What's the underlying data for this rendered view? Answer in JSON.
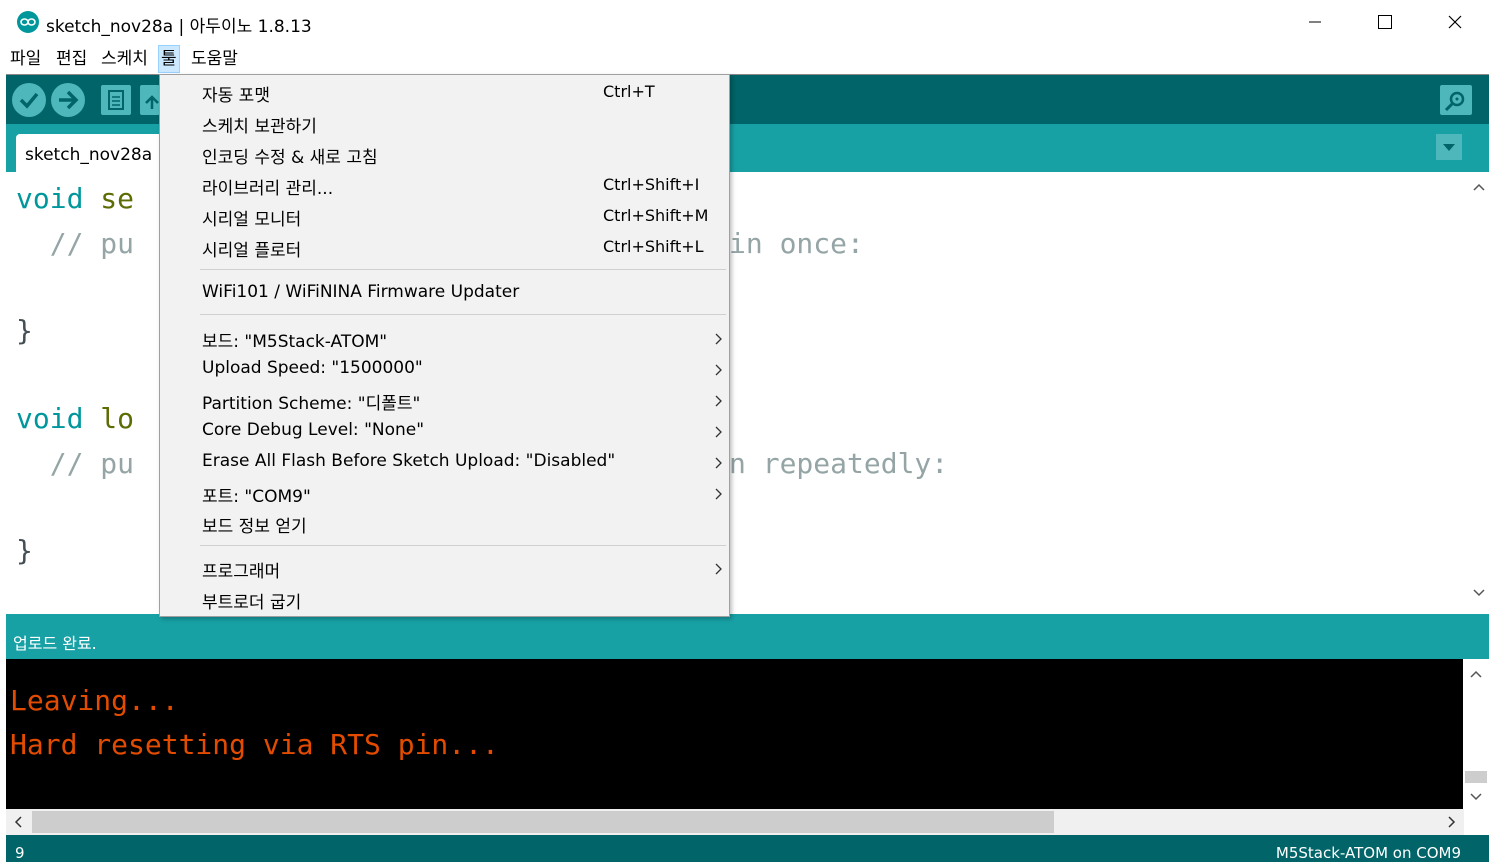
{
  "window": {
    "title": "sketch_nov28a | 아두이노 1.8.13",
    "app_icon": "arduino-logo-icon",
    "minimize_icon": "minimize-icon",
    "maximize_icon": "maximize-icon",
    "close_icon": "close-icon"
  },
  "menubar": {
    "items": [
      {
        "label": "파일"
      },
      {
        "label": "편집"
      },
      {
        "label": "스케치"
      },
      {
        "label": "툴",
        "active": true
      },
      {
        "label": "도움말"
      }
    ]
  },
  "toolbar": {
    "buttons": [
      "verify-icon",
      "upload-icon",
      "new-icon",
      "open-icon",
      "save-icon"
    ],
    "serial_monitor_icon": "serial-monitor-icon"
  },
  "tabs": {
    "items": [
      {
        "label": "sketch_nov28a"
      }
    ],
    "tab_menu_icon": "tab-menu-icon"
  },
  "editor": {
    "lines": [
      {
        "keyword": "void",
        "rest": " se"
      },
      {
        "comment_start": "  // pu",
        "comment_end": "in once:"
      },
      {
        "text": "}"
      },
      {
        "keyword": "void",
        "rest": " lo"
      },
      {
        "comment_start": "  // pu",
        "comment_end": "n repeatedly:"
      },
      {
        "text": "}"
      }
    ]
  },
  "tools_menu": {
    "groups": [
      [
        {
          "label": "자동 포맷",
          "shortcut": "Ctrl+T"
        },
        {
          "label": "스케치 보관하기",
          "shortcut": ""
        },
        {
          "label": "인코딩 수정 & 새로 고침",
          "shortcut": ""
        },
        {
          "label": "라이브러리 관리...",
          "shortcut": "Ctrl+Shift+I"
        },
        {
          "label": "시리얼 모니터",
          "shortcut": "Ctrl+Shift+M"
        },
        {
          "label": "시리얼 플로터",
          "shortcut": "Ctrl+Shift+L"
        }
      ],
      [
        {
          "label": "WiFi101 / WiFiNINA Firmware Updater",
          "shortcut": ""
        }
      ],
      [
        {
          "label": "보드: \"M5Stack-ATOM\"",
          "submenu": true
        },
        {
          "label": "Upload Speed: \"1500000\"",
          "submenu": true
        },
        {
          "label": "Partition Scheme: \"디폴트\"",
          "submenu": true
        },
        {
          "label": "Core Debug Level: \"None\"",
          "submenu": true
        },
        {
          "label": "Erase All Flash Before Sketch Upload: \"Disabled\"",
          "submenu": true
        },
        {
          "label": "포트: \"COM9\"",
          "submenu": true
        },
        {
          "label": "보드 정보 얻기",
          "submenu": false
        }
      ],
      [
        {
          "label": "프로그래머",
          "submenu": true
        },
        {
          "label": "부트로더 굽기",
          "submenu": false
        }
      ]
    ]
  },
  "status": {
    "message": "업로드 완료."
  },
  "console": {
    "lines": [
      "Leaving...",
      "Hard resetting via RTS pin..."
    ]
  },
  "footer": {
    "line_number": "9",
    "board_info": "M5Stack-ATOM on COM9"
  },
  "colors": {
    "teal_dark": "#006468",
    "teal": "#17a1a5",
    "console_text": "#e34c00",
    "keyword": "#00979c",
    "function": "#5e6d03"
  }
}
